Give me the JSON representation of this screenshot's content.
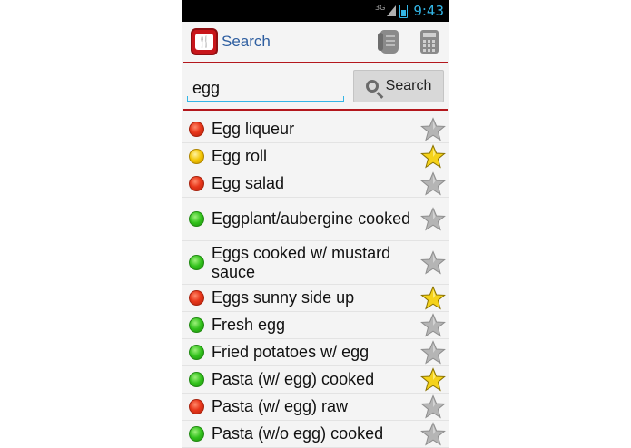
{
  "status_bar": {
    "network": "3G",
    "time": "9:43"
  },
  "action_bar": {
    "title": "Search",
    "app_icon": "food-app-icon",
    "actions": [
      {
        "icon": "scroll-icon"
      },
      {
        "icon": "calculator-icon"
      }
    ]
  },
  "search": {
    "value": "egg",
    "button_label": "Search",
    "button_icon": "magnifier-icon"
  },
  "colors": {
    "accent": "#33b5e5",
    "title": "#2e5ea0",
    "divider": "#b3171c",
    "star_on": "#f5d21a",
    "star_off": "#b5b5b5"
  },
  "results": [
    {
      "label": "Egg liqueur",
      "status": "red",
      "favorite": false
    },
    {
      "label": "Egg roll",
      "status": "yellow",
      "favorite": true
    },
    {
      "label": "Egg salad",
      "status": "red",
      "favorite": false
    },
    {
      "label": "Eggplant/aubergine cooked",
      "status": "green",
      "favorite": false
    },
    {
      "label": "Eggs cooked w/ mustard sauce",
      "status": "green",
      "favorite": false
    },
    {
      "label": "Eggs sunny side up",
      "status": "red",
      "favorite": true
    },
    {
      "label": "Fresh egg",
      "status": "green",
      "favorite": false
    },
    {
      "label": "Fried potatoes w/ egg",
      "status": "green",
      "favorite": false
    },
    {
      "label": "Pasta (w/ egg) cooked",
      "status": "green",
      "favorite": true
    },
    {
      "label": "Pasta (w/ egg) raw",
      "status": "red",
      "favorite": false
    },
    {
      "label": "Pasta (w/o egg) cooked",
      "status": "green",
      "favorite": false
    }
  ]
}
